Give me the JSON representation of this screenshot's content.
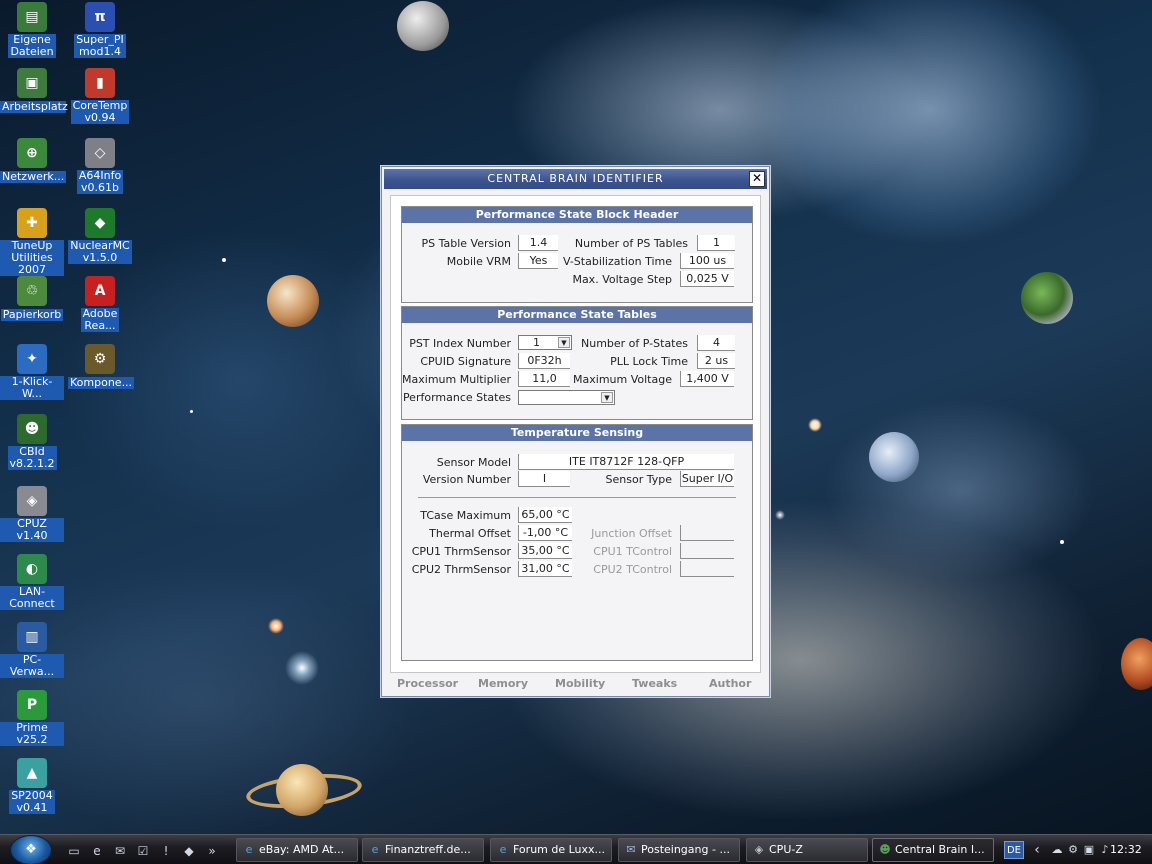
{
  "desktop": {
    "icons": [
      {
        "label": "Eigene\nDateien",
        "glyph": "▤",
        "color": "#3a7a3a"
      },
      {
        "label": "Super_PI\nmod1.4",
        "glyph": "π",
        "color": "#2b4fb0"
      },
      {
        "label": "Arbeitsplatz",
        "glyph": "▣",
        "color": "#3e7c3e"
      },
      {
        "label": "CoreTemp\nv0.94",
        "glyph": "▮",
        "color": "#c0392b"
      },
      {
        "label": "Netzwerk...",
        "glyph": "⊕",
        "color": "#3b8a3b"
      },
      {
        "label": "A64Info\nv0.61b",
        "glyph": "◇",
        "color": "#7f7f88"
      },
      {
        "label": "TuneUp\nUtilities 2007",
        "glyph": "✚",
        "color": "#d7a21a"
      },
      {
        "label": "NuclearMC\nv1.5.0",
        "glyph": "◆",
        "color": "#1c7a2a"
      },
      {
        "label": "Papierkorb",
        "glyph": "♲",
        "color": "#4e8a3e"
      },
      {
        "label": "Adobe\nRea...",
        "glyph": "A",
        "color": "#c82020"
      },
      {
        "label": "1-Klick-W...",
        "glyph": "✦",
        "color": "#2b6bc0"
      },
      {
        "label": "Kompone...",
        "glyph": "⚙",
        "color": "#6a5a2a"
      },
      {
        "label": "CBId\nv8.2.1.2",
        "glyph": "☻",
        "color": "#2d6a2d"
      },
      {
        "label": "CPUZ v1.40",
        "glyph": "◈",
        "color": "#8a8a92"
      },
      {
        "label": "LAN-Connect",
        "glyph": "◐",
        "color": "#2c8a4c"
      },
      {
        "label": "PC-Verwa...",
        "glyph": "▥",
        "color": "#2a5aa0"
      },
      {
        "label": "Prime v25.2",
        "glyph": "P",
        "color": "#2a9a3a"
      },
      {
        "label": "SP2004\nv0.41",
        "glyph": "▲",
        "color": "#3aa0a0"
      }
    ]
  },
  "window": {
    "title": "CENTRAL BRAIN IDENTIFIER",
    "close_glyph": "✕",
    "ps_header": {
      "title": "Performance State Block Header",
      "ps_table_version_label": "PS Table Version",
      "ps_table_version": "1.4",
      "mobile_vrm_label": "Mobile VRM",
      "mobile_vrm": "Yes",
      "num_ps_tables_label": "Number of PS Tables",
      "num_ps_tables": "1",
      "v_stab_label": "V-Stabilization Time",
      "v_stab": "100 us",
      "max_vstep_label": "Max. Voltage Step",
      "max_vstep": "0,025 V"
    },
    "ps_tables": {
      "title": "Performance State Tables",
      "pst_index_label": "PST Index Number",
      "pst_index": "1",
      "cpuid_label": "CPUID Signature",
      "cpuid": "0F32h",
      "max_mult_label": "Maximum Multiplier",
      "max_mult": "11,0",
      "perf_states_label": "Performance States",
      "perf_states": "",
      "num_pstates_label": "Number of P-States",
      "num_pstates": "4",
      "pll_lock_label": "PLL Lock Time",
      "pll_lock": "2 us",
      "max_voltage_label": "Maximum Voltage",
      "max_voltage": "1,400 V"
    },
    "temp": {
      "title": "Temperature Sensing",
      "sensor_model_label": "Sensor Model",
      "sensor_model": "ITE IT8712F 128-QFP",
      "version_label": "Version Number",
      "version": "I",
      "sensor_type_label": "Sensor Type",
      "sensor_type": "Super I/O",
      "tcase_label": "TCase Maximum",
      "tcase": "65,00 °C",
      "thermal_offset_label": "Thermal Offset",
      "thermal_offset": "-1,00 °C",
      "cpu1_sensor_label": "CPU1 ThrmSensor",
      "cpu1_sensor": "35,00 °C",
      "cpu2_sensor_label": "CPU2 ThrmSensor",
      "cpu2_sensor": "31,00 °C",
      "junction_offset_label": "Junction Offset",
      "junction_offset": "",
      "cpu1_tcontrol_label": "CPU1 TControl",
      "cpu1_tcontrol": "",
      "cpu2_tcontrol_label": "CPU2 TControl",
      "cpu2_tcontrol": ""
    },
    "tabs": [
      "Processor",
      "Memory",
      "Mobility",
      "Tweaks",
      "Author"
    ]
  },
  "taskbar": {
    "start_glyph": "❖",
    "quicklaunch": [
      "▭",
      "e",
      "✉",
      "☑",
      "!",
      "◆",
      "»"
    ],
    "tasks": [
      {
        "label": "eBay: AMD At...",
        "glyph": "e",
        "color": "#5aa0e6"
      },
      {
        "label": "Finanztreff.de...",
        "glyph": "e",
        "color": "#5aa0e6"
      },
      {
        "label": "Forum de Luxx...",
        "glyph": "e",
        "color": "#5aa0e6"
      },
      {
        "label": "Posteingang - ...",
        "glyph": "✉",
        "color": "#9ab4e0"
      },
      {
        "label": "CPU-Z",
        "glyph": "◈",
        "color": "#c0c0c8"
      },
      {
        "label": "Central Brain I...",
        "glyph": "☻",
        "color": "#5aa05a"
      }
    ],
    "lang": "DE",
    "tray_chevron": "‹",
    "tray_icons": [
      "☁",
      "⚙",
      "▣",
      "♪"
    ],
    "clock": "12:32"
  }
}
